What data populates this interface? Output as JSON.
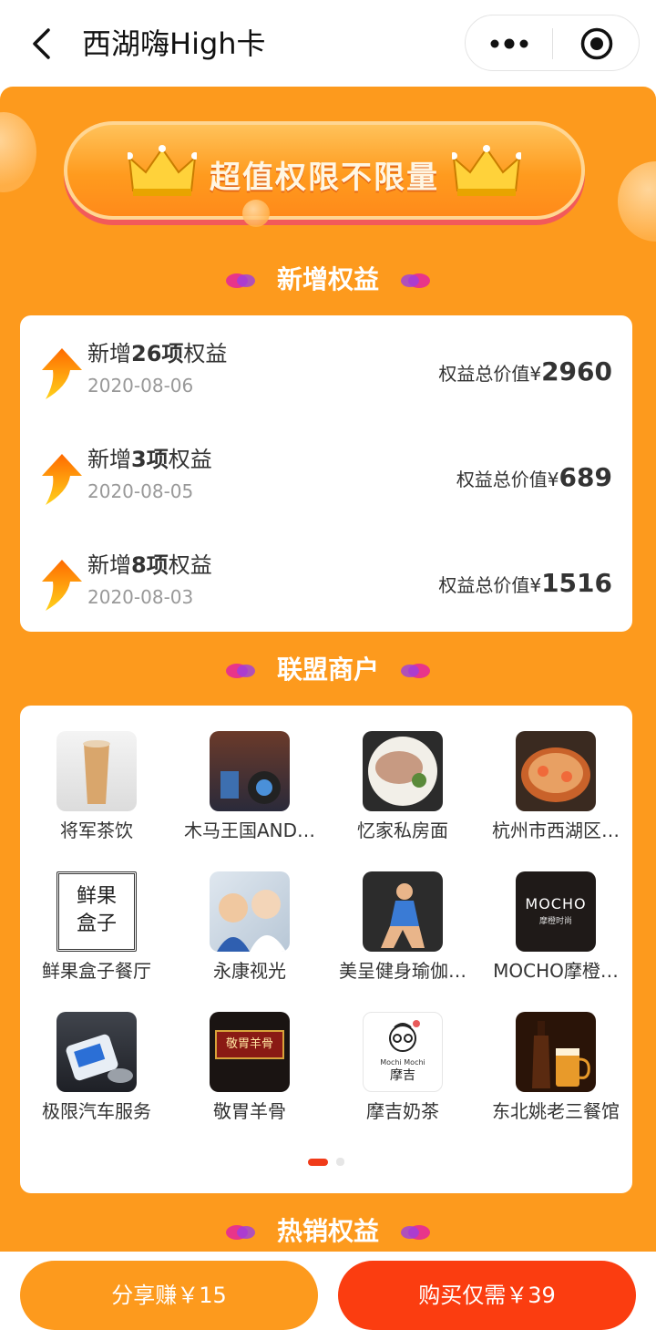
{
  "nav": {
    "title": "西湖嗨High卡",
    "back_icon": "back-chevron-icon",
    "more_icon": "more-dots-icon",
    "close_icon": "target-circle-icon"
  },
  "banner": {
    "text": "超值权限不限量",
    "crown_icon": "crown-icon"
  },
  "sections": {
    "new_benefits": "新增权益",
    "alliance": "联盟商户",
    "hot_sale": "热销权益"
  },
  "benefits": [
    {
      "prefix": "新增",
      "count": "26项",
      "suffix": "权益",
      "date": "2020-08-06",
      "value_label": "权益总价值¥",
      "value": "2960"
    },
    {
      "prefix": "新增",
      "count": "3项",
      "suffix": "权益",
      "date": "2020-08-05",
      "value_label": "权益总价值¥",
      "value": "689"
    },
    {
      "prefix": "新增",
      "count": "8项",
      "suffix": "权益",
      "date": "2020-08-03",
      "value_label": "权益总价值¥",
      "value": "1516"
    }
  ],
  "merchants": [
    {
      "name": "将军茶饮"
    },
    {
      "name": "木马王国AND…"
    },
    {
      "name": "忆家私房面"
    },
    {
      "name": "杭州市西湖区…"
    },
    {
      "name": "鲜果盒子餐厅",
      "logo_text_1": "鲜果",
      "logo_text_2": "盒子"
    },
    {
      "name": "永康视光"
    },
    {
      "name": "美呈健身瑜伽…"
    },
    {
      "name": "MOCHO摩橙…",
      "logo_text_1": "MOCHO",
      "logo_text_2": "摩橙时尚"
    },
    {
      "name": "极限汽车服务"
    },
    {
      "name": "敬胃羊骨",
      "logo_text_1": "敬胃羊骨"
    },
    {
      "name": "摩吉奶茶",
      "logo_text_1": "Mochi Mochi",
      "logo_text_2": "摩吉"
    },
    {
      "name": "东北姚老三餐馆"
    }
  ],
  "pagination": {
    "current": 1,
    "total": 2
  },
  "bottom": {
    "share_label": "分享赚￥15",
    "buy_label": "购买仅需￥39"
  },
  "colors": {
    "orange": "#fd9a1d",
    "red": "#fb3d10",
    "dot_active": "#f03b19",
    "dot_inactive": "#e6e6e6"
  }
}
